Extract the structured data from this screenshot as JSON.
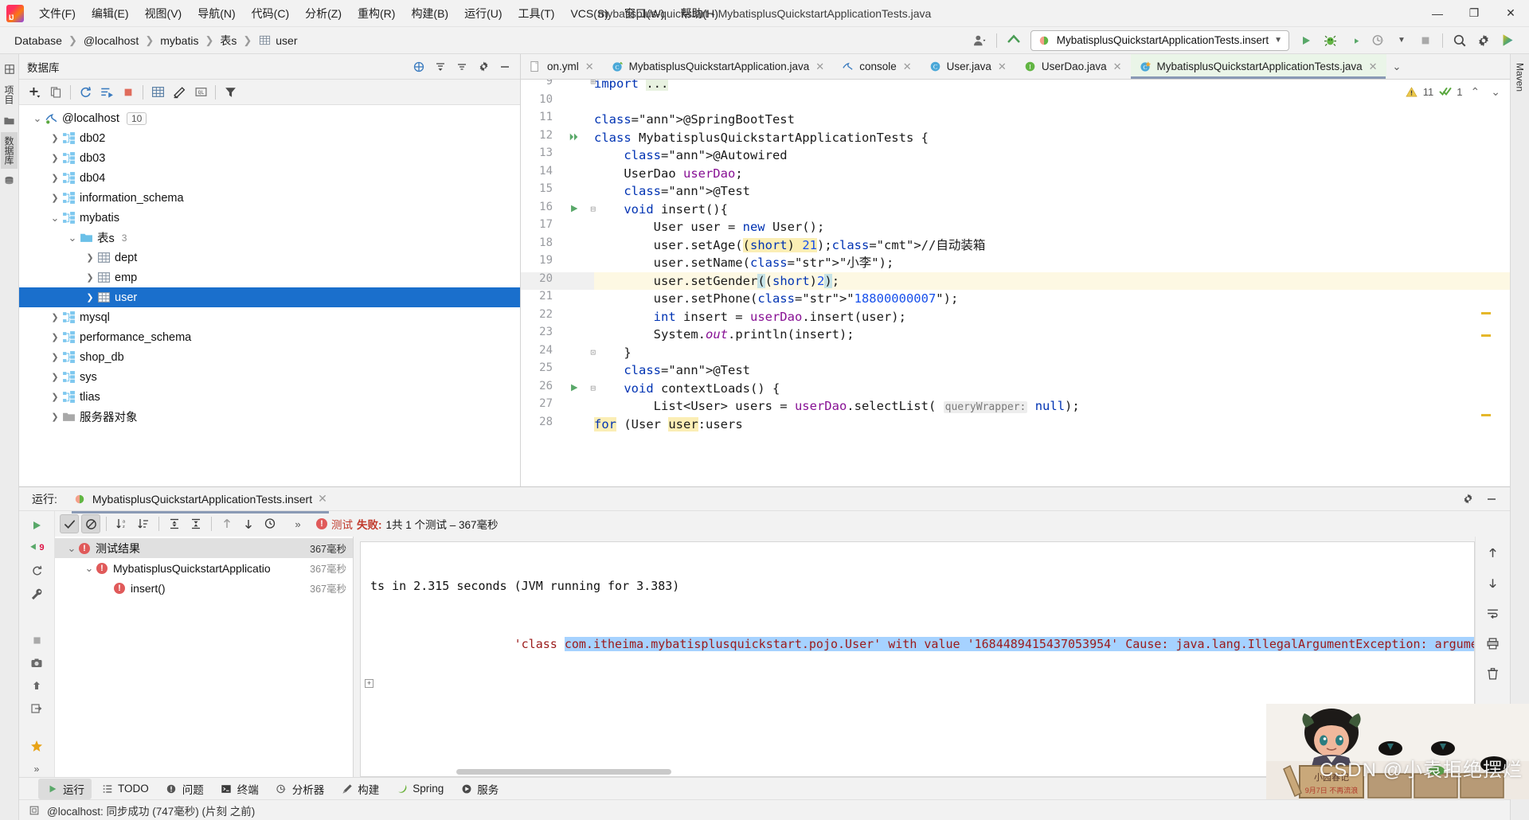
{
  "window": {
    "title": "mybatisplus-quickstart - MybatisplusQuickstartApplicationTests.java",
    "minimize": "—",
    "maximize": "❐",
    "close": "✕"
  },
  "menu": [
    {
      "label": "文件(F)"
    },
    {
      "label": "编辑(E)"
    },
    {
      "label": "视图(V)"
    },
    {
      "label": "导航(N)"
    },
    {
      "label": "代码(C)"
    },
    {
      "label": "分析(Z)"
    },
    {
      "label": "重构(R)"
    },
    {
      "label": "构建(B)"
    },
    {
      "label": "运行(U)"
    },
    {
      "label": "工具(T)"
    },
    {
      "label": "VCS(S)"
    },
    {
      "label": "窗口(W)"
    },
    {
      "label": "帮助(H)"
    }
  ],
  "breadcrumb": {
    "items": [
      "Database",
      "@localhost",
      "mybatis",
      "表s",
      "user"
    ],
    "separator": "❯"
  },
  "navbar": {
    "run_config": "MybatisplusQuickstartApplicationTests.insert",
    "run_button": "run-icon",
    "debug_button": "debug-icon",
    "coverage_button": "run-with-coverage-icon",
    "profiler_button": "profiler-icon",
    "stop_button": "stop-icon",
    "search_button": "search-icon",
    "settings_button": "settings-icon",
    "updates_button": "updates-icon",
    "account_button": "account-icon",
    "revert_button": "revert-icon"
  },
  "left_strip": {
    "project_label": "项目",
    "database_label": "数据库"
  },
  "right_strip": {
    "maven_label": "Maven"
  },
  "database_panel": {
    "title": "数据库",
    "toolbar": [
      "add-icon",
      "copy-icon",
      "refresh-icon",
      "run-sql-icon",
      "stop-icon",
      "table-icon",
      "edit-icon",
      "ql-console-icon",
      "filter-icon"
    ],
    "tree": [
      {
        "label": "@localhost",
        "badge": "10",
        "icon": "mysql-connection-icon",
        "indent": 0,
        "arrow": "down",
        "selected": false
      },
      {
        "label": "db02",
        "icon": "schema-icon",
        "indent": 1,
        "arrow": "right",
        "selected": false
      },
      {
        "label": "db03",
        "icon": "schema-icon",
        "indent": 1,
        "arrow": "right",
        "selected": false
      },
      {
        "label": "db04",
        "icon": "schema-icon",
        "indent": 1,
        "arrow": "right",
        "selected": false
      },
      {
        "label": "information_schema",
        "icon": "schema-icon",
        "indent": 1,
        "arrow": "right",
        "selected": false
      },
      {
        "label": "mybatis",
        "icon": "schema-icon",
        "indent": 1,
        "arrow": "down",
        "selected": false
      },
      {
        "label": "表s",
        "count": "3",
        "icon": "folder-icon",
        "indent": 2,
        "arrow": "down",
        "selected": false
      },
      {
        "label": "dept",
        "icon": "table-icon",
        "indent": 3,
        "arrow": "right",
        "selected": false
      },
      {
        "label": "emp",
        "icon": "table-icon",
        "indent": 3,
        "arrow": "right",
        "selected": false
      },
      {
        "label": "user",
        "icon": "table-icon",
        "indent": 3,
        "arrow": "right",
        "selected": true
      },
      {
        "label": "mysql",
        "icon": "schema-icon",
        "indent": 1,
        "arrow": "right",
        "selected": false
      },
      {
        "label": "performance_schema",
        "icon": "schema-icon",
        "indent": 1,
        "arrow": "right",
        "selected": false
      },
      {
        "label": "shop_db",
        "icon": "schema-icon",
        "indent": 1,
        "arrow": "right",
        "selected": false
      },
      {
        "label": "sys",
        "icon": "schema-icon",
        "indent": 1,
        "arrow": "right",
        "selected": false
      },
      {
        "label": "tlias",
        "icon": "schema-icon",
        "indent": 1,
        "arrow": "right",
        "selected": false
      },
      {
        "label": "服务器对象",
        "icon": "grey-folder-icon",
        "indent": 1,
        "arrow": "right",
        "selected": false
      }
    ]
  },
  "editor": {
    "tabs": [
      {
        "label": "on.yml",
        "icon": "yaml-icon",
        "active": false
      },
      {
        "label": "MybatisplusQuickstartApplication.java",
        "icon": "spring-class-icon",
        "active": false
      },
      {
        "label": "console",
        "icon": "mysql-console-icon",
        "active": false
      },
      {
        "label": "User.java",
        "icon": "class-icon",
        "active": false
      },
      {
        "label": "UserDao.java",
        "icon": "interface-icon",
        "active": false
      },
      {
        "label": "MybatisplusQuickstartApplicationTests.java",
        "icon": "test-class-icon",
        "active": true
      }
    ],
    "warnings_count": "11",
    "checks_count": "1",
    "code_lines": [
      {
        "no": "9",
        "text": "import ..."
      },
      {
        "no": "10",
        "text": ""
      },
      {
        "no": "11",
        "text": "@SpringBootTest"
      },
      {
        "no": "12",
        "text": "class MybatisplusQuickstartApplicationTests {"
      },
      {
        "no": "13",
        "text": "    @Autowired"
      },
      {
        "no": "14",
        "text": "    UserDao userDao;"
      },
      {
        "no": "15",
        "text": "    @Test"
      },
      {
        "no": "16",
        "text": "    void insert(){"
      },
      {
        "no": "17",
        "text": "        User user = new User();"
      },
      {
        "no": "18",
        "text": "        user.setAge((short) 21);//自动装箱"
      },
      {
        "no": "19",
        "text": "        user.setName(\"小李\");"
      },
      {
        "no": "20",
        "text": "        user.setGender((short)2);"
      },
      {
        "no": "21",
        "text": "        user.setPhone(\"18800000007\");"
      },
      {
        "no": "22",
        "text": "        int insert = userDao.insert(user);"
      },
      {
        "no": "23",
        "text": "        System.out.println(insert);"
      },
      {
        "no": "24",
        "text": "    }"
      },
      {
        "no": "25",
        "text": "    @Test"
      },
      {
        "no": "26",
        "text": "    void contextLoads() {"
      },
      {
        "no": "27",
        "text": "        List<User> users = userDao.selectList( queryWrapper: null);"
      },
      {
        "no": "28",
        "text": "        for (User user:users"
      }
    ],
    "param_hint": "queryWrapper:"
  },
  "run_window": {
    "label": "运行:",
    "tab_title": "MybatisplusQuickstartApplicationTests.insert",
    "toolbar": [
      "rerun-icon",
      "show-passed-icon",
      "show-ignored-icon",
      "sort-alphabetically-icon",
      "sort-by-duration-icon",
      "expand-all-icon",
      "collapse-all-icon",
      "prev-failed-icon",
      "next-failed-icon",
      "history-icon",
      "more-icon"
    ],
    "status_prefix": "测试",
    "status_failed": "失败:",
    "status_detail": "1共 1 个测试 – 367毫秒",
    "tree": [
      {
        "label": "测试结果",
        "duration": "367毫秒",
        "indent": 0,
        "arrow": "down",
        "selected": true
      },
      {
        "label": "MybatisplusQuickstartApplicatio",
        "duration": "367毫秒",
        "indent": 1,
        "arrow": "down",
        "selected": false
      },
      {
        "label": "insert()",
        "duration": "367毫秒",
        "indent": 2,
        "arrow": "",
        "selected": false
      }
    ],
    "console": {
      "line1": "ts in 2.315 seconds (JVM running for 3.383)",
      "line2_plain": "'class ",
      "line2_hl": "com.itheima.mybatisplusquickstart.pojo.User' with value '1684489415437053954' Cause: java.lang.IllegalArgumentException: argument type"
    },
    "right_icons": [
      "scroll-to-end-icon",
      "soft-wrap-icon",
      "print-icon",
      "clear-all-icon"
    ],
    "left_icons": [
      "rerun-failed-icon",
      "toggle-auto-test-icon",
      "settings-wrench-icon"
    ]
  },
  "bottom_tabs": [
    {
      "label": "运行",
      "icon": "run-icon",
      "active": true
    },
    {
      "label": "TODO",
      "icon": "todo-icon",
      "active": false
    },
    {
      "label": "问题",
      "icon": "problems-icon",
      "active": false
    },
    {
      "label": "终端",
      "icon": "terminal-icon",
      "active": false
    },
    {
      "label": "分析器",
      "icon": "profiler-icon",
      "active": false
    },
    {
      "label": "构建",
      "icon": "build-icon",
      "active": false
    },
    {
      "label": "Spring",
      "icon": "spring-icon",
      "active": false
    },
    {
      "label": "服务",
      "icon": "services-icon",
      "active": false
    }
  ],
  "status_bar": {
    "icon": "memory-icon",
    "text": "@localhost: 同步成功 (747毫秒) (片刻 之前)"
  },
  "watermark": {
    "text": "CSDN @小袁拒绝摆烂"
  },
  "colors": {
    "accent_blue": "#1a6fcc",
    "tab_active": "#eaf5e8",
    "error_red": "#c0392b",
    "keyword": "#0033b3",
    "string": "#067d17",
    "annotation": "#9e880d",
    "field": "#871094",
    "highlight_line": "#fdf8e3",
    "console_select": "#a6d2ff"
  }
}
